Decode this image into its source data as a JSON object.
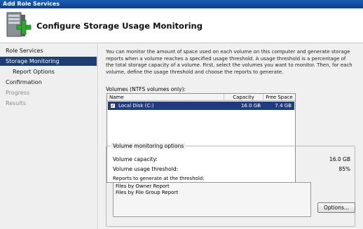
{
  "window": {
    "title": "Add Role Services"
  },
  "header": {
    "title": "Configure Storage Usage Monitoring",
    "icon": "server-plus-icon"
  },
  "sidebar": {
    "items": [
      {
        "label": "Role Services",
        "state": "normal"
      },
      {
        "label": "Storage Monitoring",
        "state": "active"
      },
      {
        "label": "Report Options",
        "state": "sub"
      },
      {
        "label": "Confirmation",
        "state": "normal"
      },
      {
        "label": "Progress",
        "state": "disabled"
      },
      {
        "label": "Results",
        "state": "disabled"
      }
    ]
  },
  "main": {
    "description": "You can monitor the amount of space used on each volume on this computer and generate storage reports when a volume reaches a specified usage threshold.  A usage threshold is a percentage of the total storage capacity of a volume. First, select the volumes you want to monitor.  Then, for each volume, define the usage threshold and choose the reports to generate.",
    "volumes_label": "Volumes (NTFS volumes only):",
    "columns": [
      "Name",
      "Capacity",
      "Free Space"
    ],
    "volumes": [
      {
        "checked": true,
        "name": "Local Disk (C:)",
        "capacity": "16.0 GB",
        "free_space": "7.4 GB"
      }
    ],
    "options_group": {
      "legend": "Volume monitoring options",
      "capacity_label": "Volume capacity:",
      "capacity_value": "16.0 GB",
      "threshold_label": "Volume usage threshold:",
      "threshold_value": "85%",
      "reports_label": "Reports to generate at the threshold:",
      "reports": [
        "Files by Owner Report",
        "Files by File Group Report"
      ]
    },
    "options_button": "Options..."
  },
  "colors": {
    "selection": "#1f3d7a",
    "titlebar": "#1a5fb4"
  }
}
